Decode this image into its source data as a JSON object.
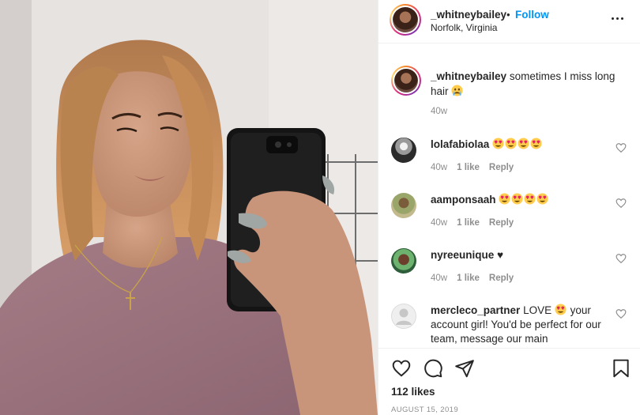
{
  "post": {
    "username": "_whitneybailey",
    "separator": "•",
    "follow_label": "Follow",
    "location": "Norfolk, Virginia",
    "caption_text": "sometimes I miss long hair",
    "caption_emoji": "crying-face",
    "caption_time": "40w",
    "likes_label": "112 likes",
    "date": "AUGUST 15, 2019"
  },
  "comments": [
    {
      "username": "lolafabiolaa",
      "text": "",
      "emojis": [
        "heart-eyes",
        "heart-eyes",
        "heart-eyes",
        "heart-eyes"
      ],
      "time": "40w",
      "likes": "1 like",
      "reply": "Reply"
    },
    {
      "username": "aamponsaah",
      "text": "",
      "emojis": [
        "heart-eyes",
        "heart-eyes",
        "heart-eyes",
        "heart-eyes"
      ],
      "time": "40w",
      "likes": "1 like",
      "reply": "Reply"
    },
    {
      "username": "nyreeunique",
      "text": "♥",
      "emojis": [],
      "time": "40w",
      "likes": "1 like",
      "reply": "Reply"
    },
    {
      "username": "mercleco_partner",
      "text_before": "LOVE",
      "text_after": "your account girl! You'd be perfect for our team, message our main",
      "emojis": [
        "heart-eyes"
      ],
      "time": "",
      "likes": "",
      "reply": ""
    }
  ],
  "icons": [
    "more-options-icon",
    "heart-icon",
    "comment-icon",
    "share-icon",
    "bookmark-icon"
  ],
  "colors": {
    "follow": "#0095f6",
    "muted": "#8e8e8e",
    "text": "#262626",
    "border": "#efefef"
  }
}
